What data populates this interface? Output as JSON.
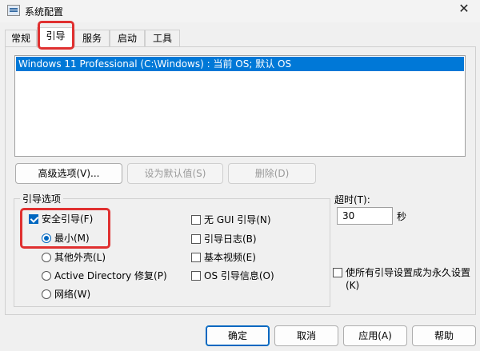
{
  "window": {
    "title": "系统配置",
    "close_glyph": "✕"
  },
  "tabs": [
    {
      "label": "常规"
    },
    {
      "label": "引导"
    },
    {
      "label": "服务"
    },
    {
      "label": "启动"
    },
    {
      "label": "工具"
    }
  ],
  "active_tab": "引导",
  "os_list": [
    {
      "label": "Windows 11 Professional (C:\\Windows) : 当前 OS; 默认 OS",
      "selected": true
    }
  ],
  "list_buttons": {
    "advanced": "高级选项(V)...",
    "set_default": "设为默认值(S)",
    "delete": "删除(D)"
  },
  "boot_options": {
    "label": "引导选项",
    "safe_boot": {
      "label": "安全引导(F)",
      "checked": true
    },
    "minimal": {
      "label": "最小(M)",
      "checked": true
    },
    "alternate_shell": {
      "label": "其他外壳(L)",
      "checked": false
    },
    "active_directory": {
      "label": "Active Directory 修复(P)",
      "checked": false
    },
    "network": {
      "label": "网络(W)",
      "checked": false
    },
    "no_gui": {
      "label": "无 GUI 引导(N)",
      "checked": false
    },
    "boot_log": {
      "label": "引导日志(B)",
      "checked": false
    },
    "base_video": {
      "label": "基本视频(E)",
      "checked": false
    },
    "os_boot_info": {
      "label": "OS 引导信息(O)",
      "checked": false
    }
  },
  "timeout": {
    "label": "超时(T):",
    "value": "30",
    "unit": "秒"
  },
  "make_permanent": {
    "line1": "使所有引导设置成为永久设置",
    "line2": "(K)",
    "checked": false
  },
  "footer": {
    "ok": "确定",
    "cancel": "取消",
    "apply": "应用(A)",
    "help": "帮助"
  },
  "colors": {
    "selection": "#0078d7",
    "highlight_outline": "#e03030",
    "accent": "#0067c0"
  }
}
